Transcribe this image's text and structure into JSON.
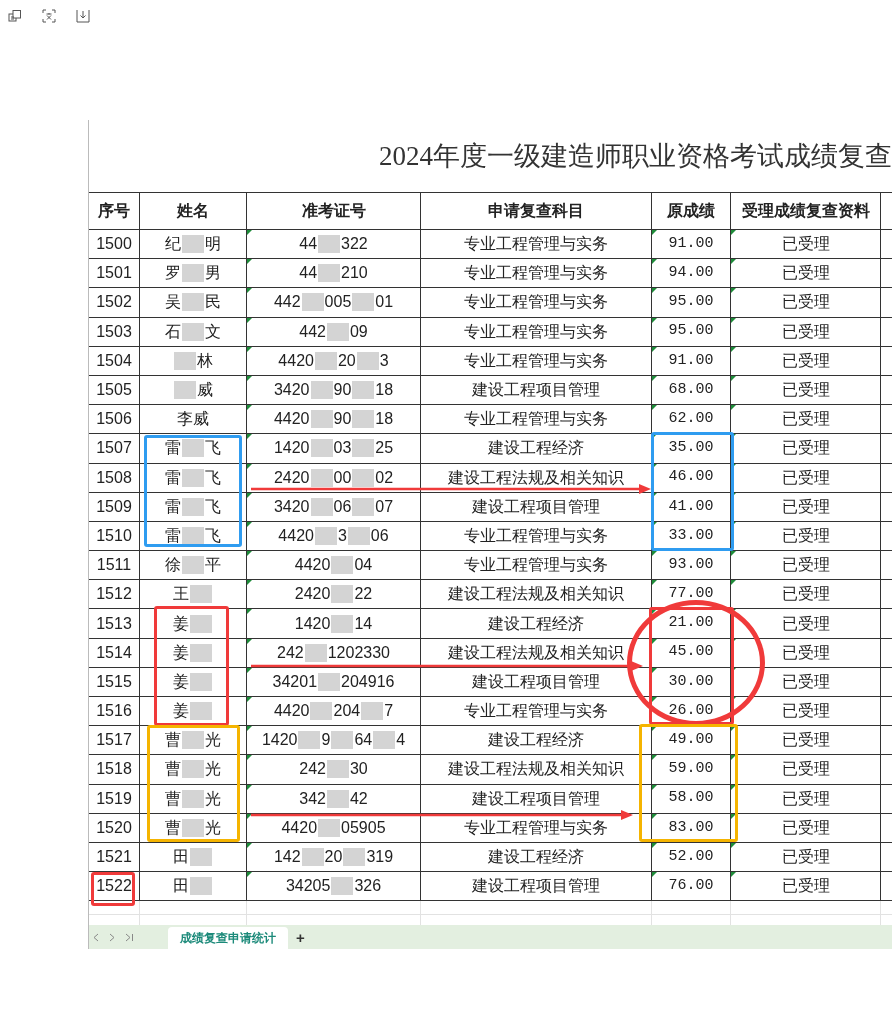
{
  "toolbar": [
    {
      "kind": "restore"
    },
    {
      "kind": "scan"
    },
    {
      "kind": "save"
    }
  ],
  "sheet": {
    "title": "2024年度一级建造师职业资格考试成绩复查",
    "columns": [
      "序号",
      "姓名",
      "准考证号",
      "申请复查科目",
      "原成绩",
      "受理成绩复查资料"
    ],
    "rows": [
      {
        "no": "1500",
        "name": [
          "纪",
          {
            "kind": "redacted"
          },
          "明"
        ],
        "id": [
          "44",
          {
            "kind": "redacted"
          },
          "322"
        ],
        "subject": "专业工程管理与实务",
        "score": "91.00",
        "status": "已受理"
      },
      {
        "no": "1501",
        "name": [
          "罗",
          {
            "kind": "redacted"
          },
          "男"
        ],
        "id": [
          "44",
          {
            "kind": "redacted"
          },
          "210"
        ],
        "subject": "专业工程管理与实务",
        "score": "94.00",
        "status": "已受理"
      },
      {
        "no": "1502",
        "name": [
          "吴",
          {
            "kind": "redacted"
          },
          "民"
        ],
        "id": [
          "442",
          {
            "kind": "redacted"
          },
          "005",
          {
            "kind": "redacted"
          },
          "01"
        ],
        "subject": "专业工程管理与实务",
        "score": "95.00",
        "status": "已受理"
      },
      {
        "no": "1503",
        "name": [
          "石",
          {
            "kind": "redacted"
          },
          "文"
        ],
        "id": [
          "442",
          {
            "kind": "redacted"
          },
          "09"
        ],
        "subject": "专业工程管理与实务",
        "score": "95.00",
        "status": "已受理"
      },
      {
        "no": "1504",
        "name": [
          {
            "kind": "redacted"
          },
          "林"
        ],
        "id": [
          "4420",
          {
            "kind": "redacted"
          },
          "20",
          {
            "kind": "redacted"
          },
          "3"
        ],
        "subject": "专业工程管理与实务",
        "score": "91.00",
        "status": "已受理"
      },
      {
        "no": "1505",
        "name": [
          {
            "kind": "redacted"
          },
          "威"
        ],
        "id": [
          "3420",
          {
            "kind": "redacted"
          },
          "90",
          {
            "kind": "redacted"
          },
          "18"
        ],
        "subject": "建设工程项目管理",
        "score": "68.00",
        "status": "已受理"
      },
      {
        "no": "1506",
        "name": [
          "李威"
        ],
        "id": [
          "4420",
          {
            "kind": "redacted"
          },
          "90",
          {
            "kind": "redacted"
          },
          "18"
        ],
        "subject": "专业工程管理与实务",
        "score": "62.00",
        "status": "已受理"
      },
      {
        "no": "1507",
        "name": [
          "雷",
          {
            "kind": "redacted"
          },
          "飞"
        ],
        "id": [
          "1420",
          {
            "kind": "redacted"
          },
          "03",
          {
            "kind": "redacted"
          },
          "25"
        ],
        "subject": "建设工程经济",
        "score": "35.00",
        "status": "已受理"
      },
      {
        "no": "1508",
        "name": [
          "雷",
          {
            "kind": "redacted"
          },
          "飞"
        ],
        "id": [
          "2420",
          {
            "kind": "redacted"
          },
          "00",
          {
            "kind": "redacted"
          },
          "02"
        ],
        "subject": "建设工程法规及相关知识",
        "score": "46.00",
        "status": "已受理"
      },
      {
        "no": "1509",
        "name": [
          "雷",
          {
            "kind": "redacted"
          },
          "飞"
        ],
        "id": [
          "3420",
          {
            "kind": "redacted"
          },
          "06",
          {
            "kind": "redacted"
          },
          "07"
        ],
        "subject": "建设工程项目管理",
        "score": "41.00",
        "status": "已受理"
      },
      {
        "no": "1510",
        "name": [
          "雷",
          {
            "kind": "redacted"
          },
          "飞"
        ],
        "id": [
          "4420",
          {
            "kind": "redacted"
          },
          "3",
          {
            "kind": "redacted"
          },
          "06"
        ],
        "subject": "专业工程管理与实务",
        "score": "33.00",
        "status": "已受理"
      },
      {
        "no": "1511",
        "name": [
          "徐",
          {
            "kind": "redacted"
          },
          "平"
        ],
        "id": [
          "4420",
          {
            "kind": "redacted"
          },
          "04"
        ],
        "subject": "专业工程管理与实务",
        "score": "93.00",
        "status": "已受理"
      },
      {
        "no": "1512",
        "name": [
          "王",
          {
            "kind": "redacted"
          }
        ],
        "id": [
          "2420",
          {
            "kind": "redacted"
          },
          "22"
        ],
        "subject": "建设工程法规及相关知识",
        "score": "77.00",
        "status": "已受理"
      },
      {
        "no": "1513",
        "name": [
          "姜",
          {
            "kind": "redacted"
          }
        ],
        "id": [
          "1420",
          {
            "kind": "redacted"
          },
          "14"
        ],
        "subject": "建设工程经济",
        "score": "21.00",
        "status": "已受理"
      },
      {
        "no": "1514",
        "name": [
          "姜",
          {
            "kind": "redacted"
          }
        ],
        "id": [
          "242",
          {
            "kind": "redacted"
          },
          "1202330"
        ],
        "subject": "建设工程法规及相关知识",
        "score": "45.00",
        "status": "已受理"
      },
      {
        "no": "1515",
        "name": [
          "姜",
          {
            "kind": "redacted"
          }
        ],
        "id": [
          "34201",
          {
            "kind": "redacted"
          },
          "204916"
        ],
        "subject": "建设工程项目管理",
        "score": "30.00",
        "status": "已受理"
      },
      {
        "no": "1516",
        "name": [
          "姜",
          {
            "kind": "redacted"
          }
        ],
        "id": [
          "4420",
          {
            "kind": "redacted"
          },
          "204",
          {
            "kind": "redacted"
          },
          "7"
        ],
        "subject": "专业工程管理与实务",
        "score": "26.00",
        "status": "已受理"
      },
      {
        "no": "1517",
        "name": [
          "曹",
          {
            "kind": "redacted"
          },
          "光"
        ],
        "id": [
          "1420",
          {
            "kind": "redacted"
          },
          "9",
          {
            "kind": "redacted"
          },
          "64",
          {
            "kind": "redacted"
          },
          "4"
        ],
        "subject": "建设工程经济",
        "score": "49.00",
        "status": "已受理"
      },
      {
        "no": "1518",
        "name": [
          "曹",
          {
            "kind": "redacted"
          },
          "光"
        ],
        "id": [
          "242",
          {
            "kind": "redacted"
          },
          "30"
        ],
        "subject": "建设工程法规及相关知识",
        "score": "59.00",
        "status": "已受理"
      },
      {
        "no": "1519",
        "name": [
          "曹",
          {
            "kind": "redacted"
          },
          "光"
        ],
        "id": [
          "342",
          {
            "kind": "redacted"
          },
          "42"
        ],
        "subject": "建设工程项目管理",
        "score": "58.00",
        "status": "已受理"
      },
      {
        "no": "1520",
        "name": [
          "曹",
          {
            "kind": "redacted"
          },
          "光"
        ],
        "id": [
          "4420",
          {
            "kind": "redacted"
          },
          "05905"
        ],
        "subject": "专业工程管理与实务",
        "score": "83.00",
        "status": "已受理"
      },
      {
        "no": "1521",
        "name": [
          "田",
          {
            "kind": "redacted"
          }
        ],
        "id": [
          "142",
          {
            "kind": "redacted"
          },
          "20",
          {
            "kind": "redacted"
          },
          "319"
        ],
        "subject": "建设工程经济",
        "score": "52.00",
        "status": "已受理"
      },
      {
        "no": "1522",
        "name": [
          "田",
          {
            "kind": "redacted"
          }
        ],
        "id": [
          "34205",
          {
            "kind": "redacted"
          },
          "326"
        ],
        "subject": "建设工程项目管理",
        "score": "76.00",
        "status": "已受理"
      }
    ]
  },
  "annotations": [
    {
      "kind": "box",
      "color": "#2f9cf0"
    },
    {
      "kind": "box",
      "color": "#2f9cf0"
    },
    {
      "kind": "arrow",
      "color": "#f03a3a"
    },
    {
      "kind": "box",
      "color": "#f03a3a"
    },
    {
      "kind": "box",
      "color": "#f03a3a"
    },
    {
      "kind": "circle",
      "color": "#f03a3a"
    },
    {
      "kind": "arrow",
      "color": "#f03a3a"
    },
    {
      "kind": "box",
      "color": "#f5b400"
    },
    {
      "kind": "box",
      "color": "#f5b400"
    },
    {
      "kind": "arrow",
      "color": "#f03a3a"
    },
    {
      "kind": "box",
      "color": "#f03a3a"
    }
  ],
  "sheet_tabs": {
    "tabs": [
      {
        "label": "成绩复查申请统计",
        "selected": true
      }
    ],
    "add": "+"
  }
}
